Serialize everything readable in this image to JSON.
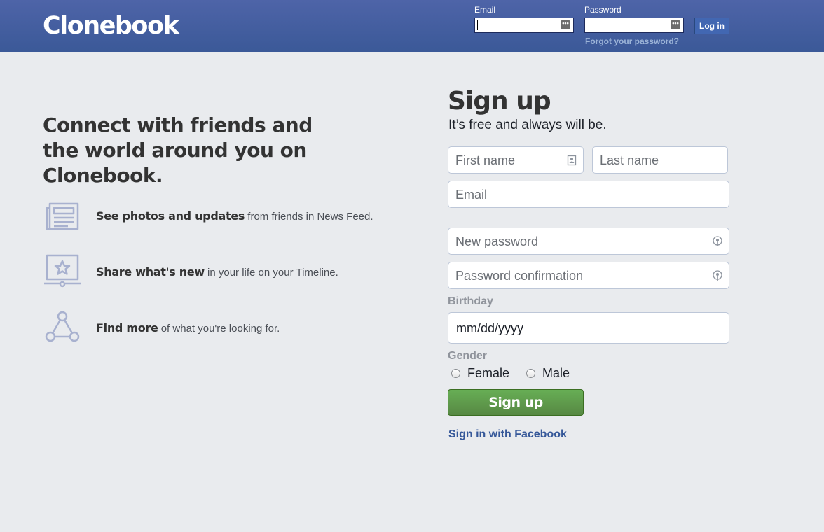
{
  "header": {
    "logo": "Clonebook",
    "email_label": "Email",
    "password_label": "Password",
    "login_button": "Log in",
    "forgot_link": "Forgot your password?",
    "password_badge": "•••"
  },
  "hero": {
    "tagline": "Connect with friends and the world around you on Clonebook.",
    "features": [
      {
        "icon": "newsfeed-icon",
        "bold": "See photos and updates",
        "rest": " from friends in News Feed."
      },
      {
        "icon": "timeline-star-icon",
        "bold": "Share what's new",
        "rest": " in your life on your Timeline."
      },
      {
        "icon": "network-icon",
        "bold": "Find more",
        "rest": " of what you're looking for."
      }
    ]
  },
  "signup": {
    "title": "Sign up",
    "subtitle": "It’s free and always will be.",
    "first_name_placeholder": "First name",
    "last_name_placeholder": "Last name",
    "email_placeholder": "Email",
    "new_password_placeholder": "New password",
    "password_confirm_placeholder": "Password confirmation",
    "birthday_label": "Birthday",
    "birthday_value": "mm/dd/yyyy",
    "gender_label": "Gender",
    "gender_options": [
      "Female",
      "Male"
    ],
    "submit_button": "Sign up",
    "facebook_link": "Sign in with Facebook"
  },
  "colors": {
    "header_blue": "#3b5998",
    "link_blue": "#365899",
    "signup_green": "#5b9b45",
    "background": "#e9ebee"
  }
}
